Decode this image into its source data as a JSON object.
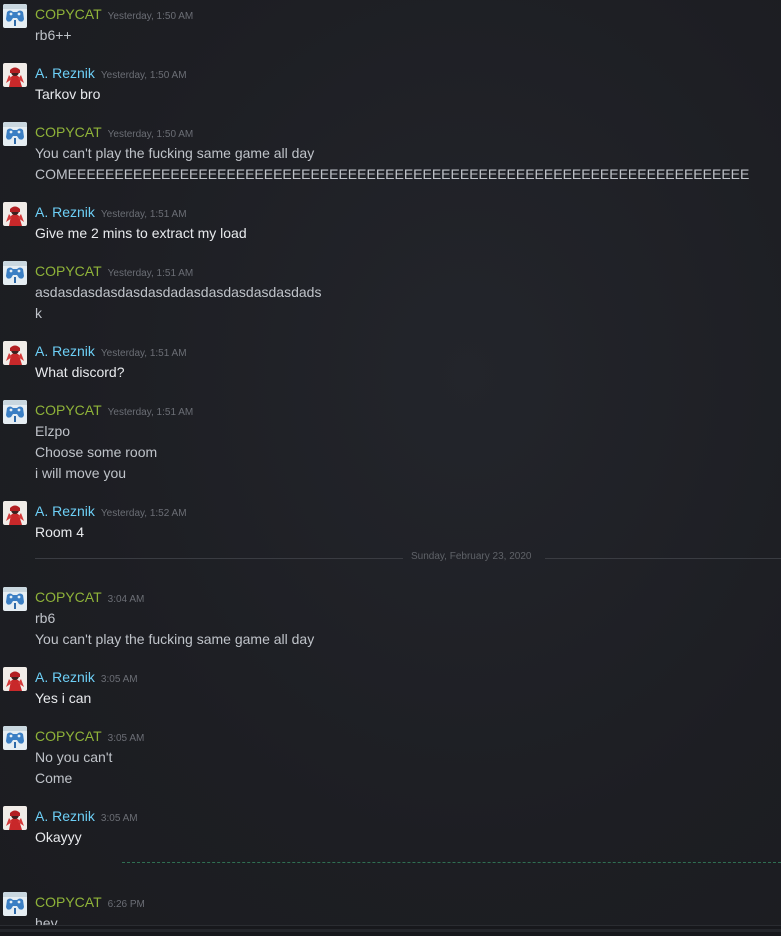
{
  "users": {
    "copycat": {
      "name": "COPYCAT",
      "color": "#8fb339",
      "avatar_icon": "blue-controller-avatar-icon"
    },
    "reznik": {
      "name": "A. Reznik",
      "color": "#6dcff6",
      "avatar_icon": "red-character-avatar-icon"
    }
  },
  "messages": [
    {
      "user": "copycat",
      "time": "Yesterday, 1:50 AM",
      "lines": [
        "rb6++"
      ]
    },
    {
      "user": "reznik",
      "time": "Yesterday, 1:50 AM",
      "lines": [
        "Tarkov bro"
      ]
    },
    {
      "user": "copycat",
      "time": "Yesterday, 1:50 AM",
      "lines": [
        "You can't play the fucking same game all day",
        "COMEEEEEEEEEEEEEEEEEEEEEEEEEEEEEEEEEEEEEEEEEEEEEEEEEEEEEEEEEEEEEEEEEEEEEEEEE"
      ]
    },
    {
      "user": "reznik",
      "time": "Yesterday, 1:51 AM",
      "lines": [
        "Give me 2 mins to extract my load"
      ]
    },
    {
      "user": "copycat",
      "time": "Yesterday, 1:51 AM",
      "lines": [
        "asdasdasdasdasdasdadasdasdasdasdasdads",
        "k"
      ]
    },
    {
      "user": "reznik",
      "time": "Yesterday, 1:51 AM",
      "lines": [
        "What discord?"
      ]
    },
    {
      "user": "copycat",
      "time": "Yesterday, 1:51 AM",
      "lines": [
        "Elzpo",
        "Choose some room",
        "i will move you"
      ]
    },
    {
      "user": "reznik",
      "time": "Yesterday, 1:52 AM",
      "lines": [
        "Room 4"
      ]
    },
    {
      "user": "copycat",
      "time": "3:04 AM",
      "lines": [
        "rb6",
        "You can't play the fucking same game all day"
      ]
    },
    {
      "user": "reznik",
      "time": "3:05 AM",
      "lines": [
        "Yes i can"
      ]
    },
    {
      "user": "copycat",
      "time": "3:05 AM",
      "lines": [
        "No you can't",
        "Come"
      ]
    },
    {
      "user": "reznik",
      "time": "3:05 AM",
      "lines": [
        "Okayyy"
      ]
    },
    {
      "user": "copycat",
      "time": "6:26 PM",
      "lines": [
        "hey"
      ]
    }
  ],
  "date_divider": {
    "label": "Sunday, February 23, 2020"
  }
}
